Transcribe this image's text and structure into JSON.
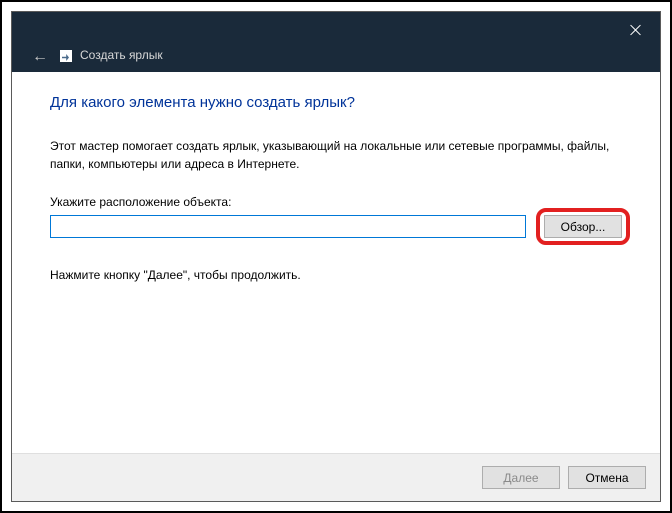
{
  "window": {
    "title": "Создать ярлык"
  },
  "content": {
    "heading": "Для какого элемента нужно создать ярлык?",
    "description": "Этот мастер помогает создать ярлык, указывающий на локальные или сетевые программы, файлы, папки, компьютеры или адреса в Интернете.",
    "path_label": "Укажите расположение объекта:",
    "path_value": "",
    "browse_label": "Обзор...",
    "instruction": "Нажмите кнопку \"Далее\", чтобы продолжить."
  },
  "footer": {
    "next_label": "Далее",
    "cancel_label": "Отмена"
  }
}
